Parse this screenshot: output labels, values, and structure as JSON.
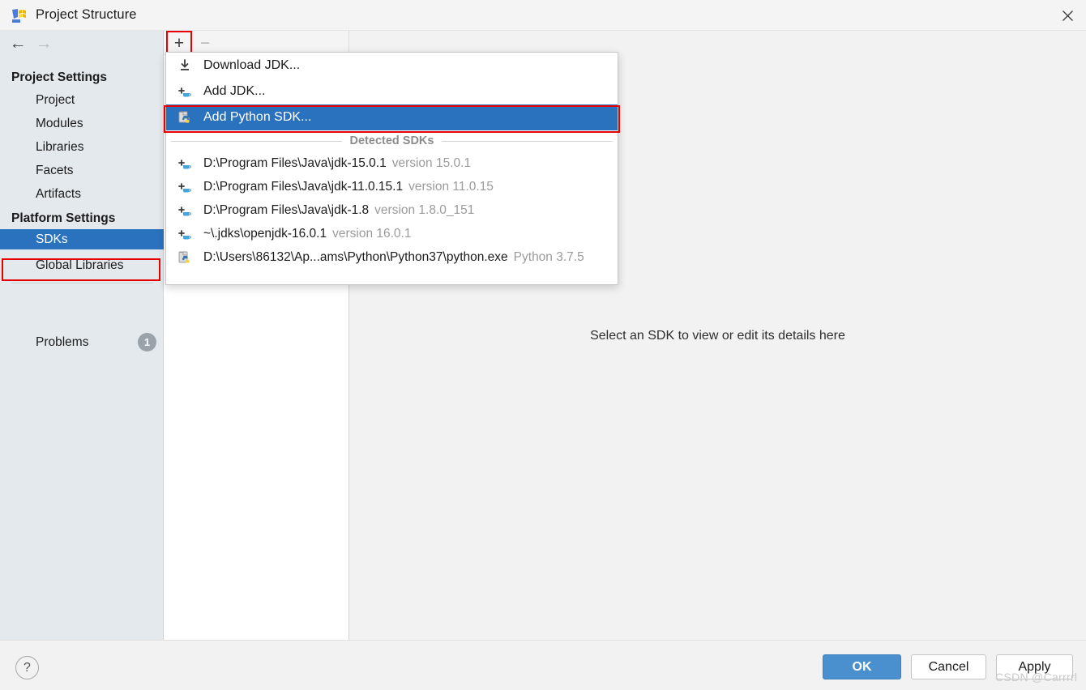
{
  "window": {
    "title": "Project Structure",
    "app_icon": "intellij-idea-icon",
    "close_label": "✕"
  },
  "sidebar": {
    "back_arrow": "←",
    "forward_arrow": "→",
    "groups": [
      {
        "header": "Project Settings",
        "items": [
          {
            "label": "Project",
            "selected": false
          },
          {
            "label": "Modules",
            "selected": false
          },
          {
            "label": "Libraries",
            "selected": false
          },
          {
            "label": "Facets",
            "selected": false
          },
          {
            "label": "Artifacts",
            "selected": false
          }
        ]
      },
      {
        "header": "Platform Settings",
        "items": [
          {
            "label": "SDKs",
            "selected": true
          },
          {
            "label": "Global Libraries",
            "selected": false
          }
        ]
      }
    ],
    "problems": {
      "label": "Problems",
      "count": "1"
    }
  },
  "toolbar": {
    "add_label": "+",
    "remove_label": "−"
  },
  "menu": {
    "actions": [
      {
        "label": "Download JDK...",
        "icon": "download-jdk-icon",
        "highlighted": false
      },
      {
        "label": "Add JDK...",
        "icon": "add-jdk-icon",
        "highlighted": false
      },
      {
        "label": "Add Python SDK...",
        "icon": "python-sdk-icon",
        "highlighted": true
      }
    ],
    "section_label": "Detected SDKs",
    "detected": [
      {
        "path": "D:\\Program Files\\Java\\jdk-15.0.1",
        "version": "version 15.0.1",
        "icon": "add-jdk-icon"
      },
      {
        "path": "D:\\Program Files\\Java\\jdk-11.0.15.1",
        "version": "version 11.0.15",
        "icon": "add-jdk-icon"
      },
      {
        "path": "D:\\Program Files\\Java\\jdk-1.8",
        "version": "version 1.8.0_151",
        "icon": "add-jdk-icon"
      },
      {
        "path": "~\\.jdks\\openjdk-16.0.1",
        "version": "version 16.0.1",
        "icon": "add-jdk-icon"
      },
      {
        "path": "D:\\Users\\86132\\Ap...ams\\Python\\Python37\\python.exe",
        "version": "Python 3.7.5",
        "icon": "python-sdk-icon"
      }
    ]
  },
  "detail": {
    "empty_message": "Select an SDK to view or edit its details here"
  },
  "footer": {
    "help_label": "?",
    "ok_label": "OK",
    "cancel_label": "Cancel",
    "apply_label": "Apply",
    "watermark": "CSDN @Carrrrl"
  },
  "colors": {
    "accent_blue": "#2a72bd",
    "primary_button": "#4a8fce",
    "highlight_red": "#e60000",
    "sidebar_bg": "#e4e9ed",
    "panel_bg": "#f2f2f2"
  }
}
